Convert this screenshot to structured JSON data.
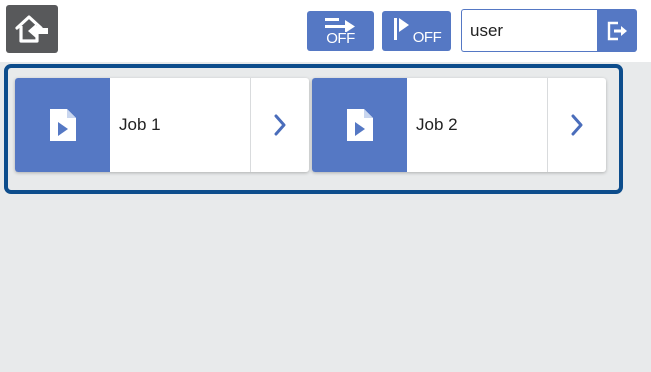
{
  "header": {
    "home_icon": "home-return-icon",
    "transfer_button": {
      "icon": "send-arrow-icon",
      "status": "OFF"
    },
    "autostart_button": {
      "icon": "autostart-icon",
      "status": "OFF"
    },
    "user": {
      "value": "user"
    },
    "logout_icon": "logout-icon"
  },
  "jobs": [
    {
      "label": "Job 1",
      "icon": "document-play-icon",
      "arrow_icon": "chevron-right-icon"
    },
    {
      "label": "Job 2",
      "icon": "document-play-icon",
      "arrow_icon": "chevron-right-icon"
    }
  ],
  "colors": {
    "accent": "#5578c4",
    "selection_frame": "#0d4d8c",
    "home_button": "#58595b",
    "panel_background": "#e8eaeb"
  }
}
